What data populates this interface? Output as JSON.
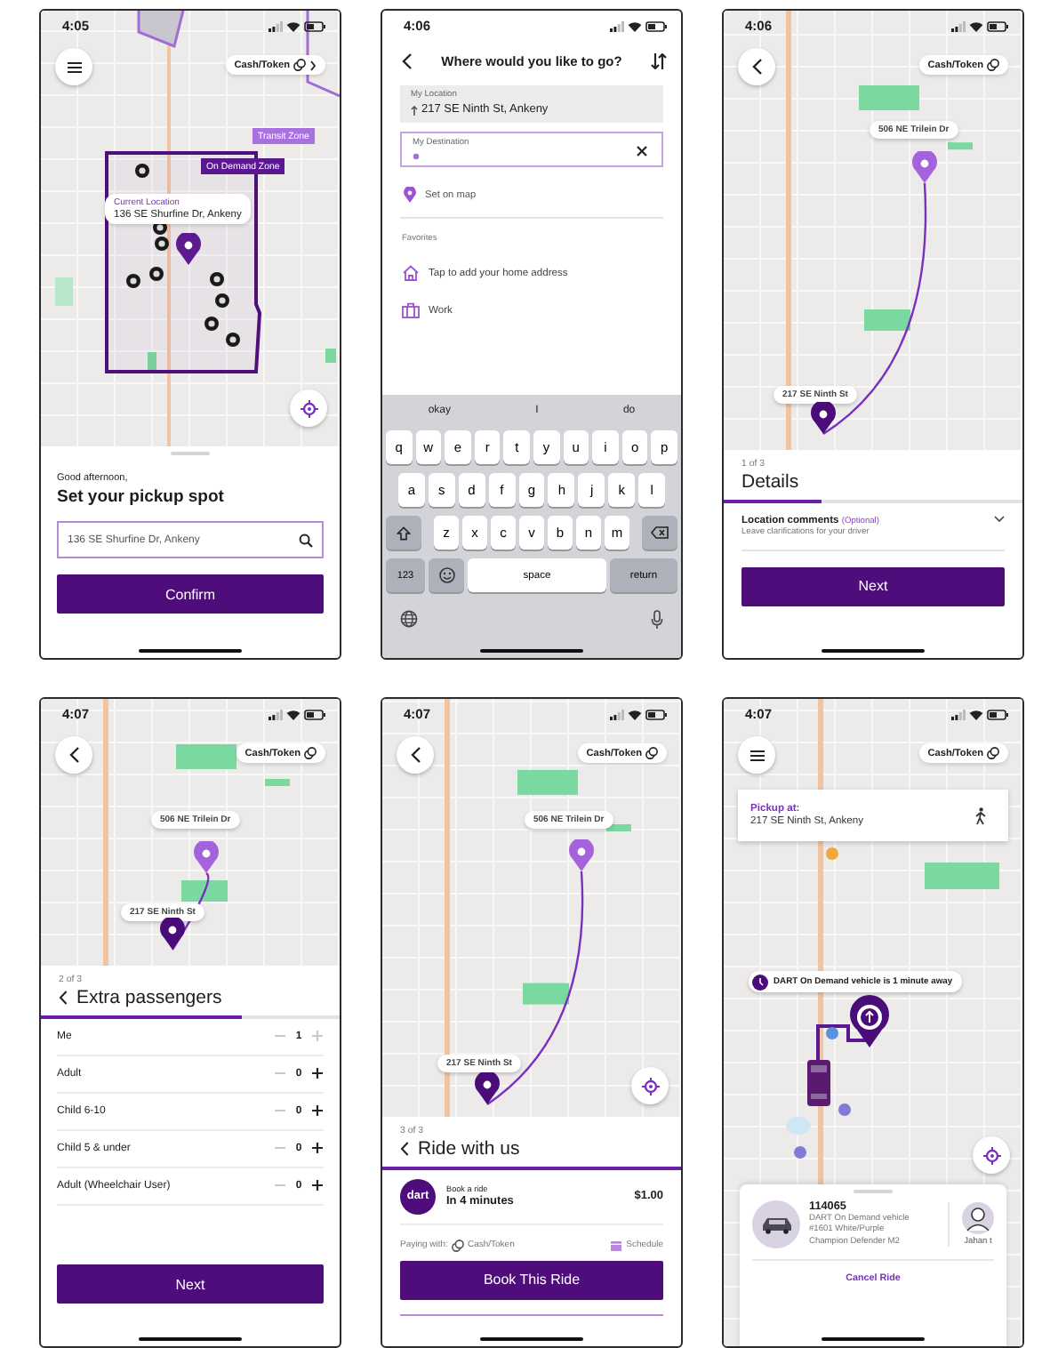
{
  "screens": [
    {
      "kind": "pickup",
      "time": "4:05",
      "fare_chip": "Cash/Token",
      "zones": [
        {
          "label": "Transit Zone",
          "color": "#a970e0"
        },
        {
          "label": "On Demand Zone",
          "color": "#5a1790"
        }
      ],
      "location": {
        "title": "Current Location",
        "address": "136 SE Shurfine Dr, Ankeny"
      },
      "greeting": "Good afternoon,",
      "heading": "Set your pickup spot",
      "search": {
        "value": "136 SE Shurfine Dr, Ankeny"
      },
      "button": "Confirm"
    },
    {
      "kind": "destination",
      "time": "4:06",
      "title": "Where would you like to go?",
      "origin": {
        "label": "My Location",
        "value": "217 SE Ninth St, Ankeny"
      },
      "destination": {
        "label": "My Destination"
      },
      "set_on_map": "Set on map",
      "favorites_heading": "Favorites",
      "favorites": [
        {
          "kind": "home",
          "label": "Tap to add your home address"
        },
        {
          "kind": "work",
          "label": "Work"
        }
      ],
      "keyboard": {
        "suggestions": [
          "okay",
          "I",
          "do"
        ],
        "rows": [
          [
            "q",
            "w",
            "e",
            "r",
            "t",
            "y",
            "u",
            "i",
            "o",
            "p"
          ],
          [
            "a",
            "s",
            "d",
            "f",
            "g",
            "h",
            "j",
            "k",
            "l"
          ],
          [
            "z",
            "x",
            "c",
            "v",
            "b",
            "n",
            "m"
          ]
        ],
        "numbers_key": "123",
        "space_key": "space",
        "return_key": "return"
      }
    },
    {
      "kind": "details",
      "time": "4:06",
      "fare_chip": "Cash/Token",
      "dropoff": "506 NE Trilein Dr",
      "pickup": "217 SE Ninth St",
      "step": "1 of 3",
      "title": "Details",
      "progress": {
        "level": 0.33
      },
      "comment": {
        "label": "Location comments",
        "optional": "(Optional)",
        "hint": "Leave clarifications for your driver"
      },
      "button": "Next"
    },
    {
      "kind": "passengers",
      "time": "4:07",
      "fare_chip": "Cash/Token",
      "dropoff": "506 NE Trilein Dr",
      "pickup": "217 SE Ninth St",
      "step": "2 of 3",
      "title": "Extra passengers",
      "progress": {
        "level": 0.67
      },
      "passengers": [
        {
          "label": "Me",
          "count": "1",
          "minus_disabled": true,
          "plus_disabled": true
        },
        {
          "label": "Adult",
          "count": "0",
          "minus_disabled": true,
          "plus_disabled": false
        },
        {
          "label": "Child 6-10",
          "count": "0",
          "minus_disabled": true,
          "plus_disabled": false
        },
        {
          "label": "Child 5 & under",
          "count": "0",
          "minus_disabled": true,
          "plus_disabled": false
        },
        {
          "label": "Adult (Wheelchair User)",
          "count": "0",
          "minus_disabled": true,
          "plus_disabled": false
        }
      ],
      "button": "Next"
    },
    {
      "kind": "ride",
      "time": "4:07",
      "fare_chip": "Cash/Token",
      "dropoff": "506 NE Trilein Dr",
      "pickup": "217 SE Ninth St",
      "step": "3 of 3",
      "title": "Ride with us",
      "progress": {
        "level": 1
      },
      "logo": "dart",
      "ride_label": "Book a ride",
      "eta": "In 4 minutes",
      "price": "$1.00",
      "paying_label": "Paying with:",
      "payment": "Cash/Token",
      "schedule": "Schedule",
      "button": "Book This Ride"
    },
    {
      "kind": "tracking",
      "time": "4:07",
      "fare_chip": "Cash/Token",
      "pickup_label": "Pickup at:",
      "pickup_address": "217 SE Ninth St, Ankeny",
      "eta_banner": "DART On Demand vehicle is 1 minute away",
      "vehicle": {
        "id": "114065",
        "description": "DART On Demand vehicle #1601 White/Purple Champion Defender M2"
      },
      "driver": "Jahan t",
      "cancel": "Cancel Ride"
    }
  ]
}
